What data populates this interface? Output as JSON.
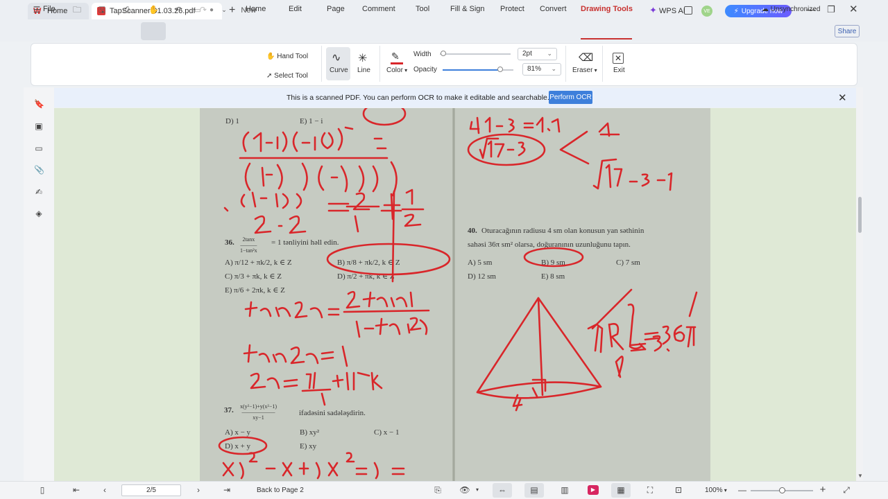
{
  "titlebar": {
    "home_tab": "Home",
    "doc_tab": "TapScanner-01.03.26.pdf",
    "new_tab": "New",
    "avatar_initials": "VE",
    "upgrade_label": "Upgrade now"
  },
  "menubar": {
    "file": "File",
    "items": [
      "Home",
      "Edit",
      "Page",
      "Comment",
      "Tool",
      "Fill & Sign",
      "Protect",
      "Convert",
      "Drawing Tools",
      "WPS AI"
    ],
    "sync_status": "Unsynchronized",
    "share": "Share"
  },
  "ribbon": {
    "hand_tool": "Hand Tool",
    "select_tool": "Select Tool",
    "curve": "Curve",
    "line": "Line",
    "color": "Color",
    "width_label": "Width",
    "width_value": "2pt",
    "opacity_label": "Opacity",
    "opacity_value": "81%",
    "width_level_fraction": 0.05,
    "opacity_level_fraction": 0.81,
    "pen_color": "#d9262a",
    "eraser": "Eraser",
    "exit": "Exit"
  },
  "ocr_banner": {
    "message": "This is a scanned PDF. You can perform OCR to make it editable and searchable.",
    "button": "Perform OCR"
  },
  "document": {
    "q35_d": "D) 1",
    "q35_e": "E) 1 − i",
    "q36_num": "36.",
    "q36_text": "= 1 tənliyini həll edin.",
    "q36_a": "A) π/12 + πk/2, k ∈ Z",
    "q36_b": "B) π/8 + πk/2, k ∈ Z",
    "q36_c": "C) π/3 + πk, k ∈ Z",
    "q36_d": "D) π/2 + πk, k ∈ Z",
    "q36_e": "E) π/6 + 2πk, k ∈ Z",
    "q37_num": "37.",
    "q37_text": "ifadəsini sadələşdirin.",
    "q37_a": "A) x − y",
    "q37_b": "B) xy²",
    "q37_c": "C) x − 1",
    "q37_d": "D) x + y",
    "q37_e": "E) xy",
    "q40_num": "40.",
    "q40_line1": "Oturacağının radiusu 4 sm olan konusun yan səthinin",
    "q40_line2": "sahəsi 36π sm² olarsa, doğuranının uzunluğunu tapın.",
    "q40_a": "A) 5 sm",
    "q40_b": "B) 9 sm",
    "q40_c": "C) 7 sm",
    "q40_d": "D) 12 sm",
    "q40_e": "E) 8 sm"
  },
  "statusbar": {
    "page_indicator": "2/5",
    "back_to_page": "Back to Page 2",
    "zoom": "100%",
    "zoom_level_fraction": 0.5
  }
}
